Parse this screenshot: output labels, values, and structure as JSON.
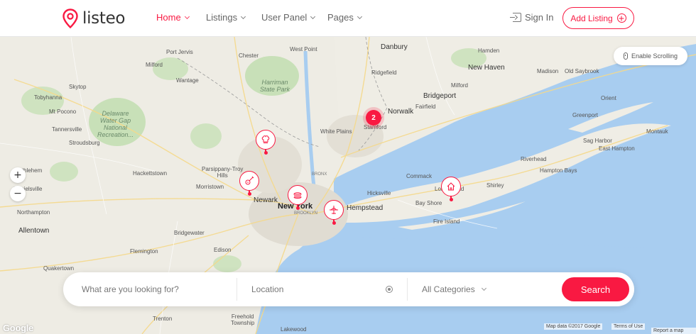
{
  "brand": {
    "name": "listeo",
    "accent": "#f91942"
  },
  "nav": [
    {
      "label": "Home",
      "active": true
    },
    {
      "label": "Listings",
      "active": false
    },
    {
      "label": "User Panel",
      "active": false
    },
    {
      "label": "Pages",
      "active": false
    }
  ],
  "header": {
    "signin_label": "Sign In",
    "add_listing_label": "Add Listing"
  },
  "map": {
    "enable_scrolling_label": "Enable Scrolling",
    "zoom_in": "+",
    "zoom_out": "−",
    "cluster_count": "2",
    "google_label": "Google",
    "map_data_label": "Map data ©2017 Google",
    "terms_label": "Terms of Use",
    "report_label": "Report a map error",
    "places": {
      "danbury": "Danbury",
      "chester": "Chester",
      "west_point": "West Point",
      "fort_jervis": "Port Jervis",
      "milford_pa": "Milford",
      "wantage": "Wantage",
      "harriman": "Harriman\nState Park",
      "hamden": "Hamden",
      "new_haven": "New Haven",
      "madison": "Madison",
      "old_saybrook": "Old Saybrook",
      "ridgefield": "Ridgefield",
      "milford_ct": "Milford",
      "bridgeport": "Bridgeport",
      "fairfield": "Fairfield",
      "norwalk": "Norwalk",
      "stamford": "Stamford",
      "white_plains": "White Plains",
      "orient": "Orient",
      "greenport": "Greenport",
      "montauk": "Montauk",
      "sag_harbor": "Sag Harbor",
      "east_hampton": "East Hampton",
      "riverhead": "Riverhead",
      "hampton_bays": "Hampton Bays",
      "shirley": "Shirley",
      "commack": "Commack",
      "hicksville": "Hicksville",
      "hempstead": "Hempstead",
      "bay_shore": "Bay Shore",
      "fire_island": "Fire Island",
      "long_island": "Long Island",
      "skytop": "Skytop",
      "tobyhanna": "Tobyhanna",
      "mt_pocono": "Mt Pocono",
      "delaware": "Delaware\nWater Gap\nNational\nRecreation...",
      "tannersville": "Tannersville",
      "stroudsburg": "Stroudsburg",
      "parsippany": "Parsippany-Troy\nHills",
      "hackettstown": "Hackettstown",
      "morristown": "Morristown",
      "newark": "Newark",
      "new_york": "New York",
      "bronx": "BRONX",
      "brooklyn": "BROOKLYN",
      "bethlehem": "Bethlehem",
      "danielsville": "Danielsville",
      "northampton": "Northampton",
      "allentown": "Allentown",
      "bridgewater": "Bridgewater",
      "edison": "Edison",
      "flemington": "Flemington",
      "quakertown": "Quakertown",
      "trenton": "Trenton",
      "freehold": "Freehold\nTownship",
      "lakewood": "Lakewood"
    }
  },
  "search": {
    "what_placeholder": "What are you looking for?",
    "location_placeholder": "Location",
    "category_value": "All Categories",
    "button_label": "Search"
  }
}
